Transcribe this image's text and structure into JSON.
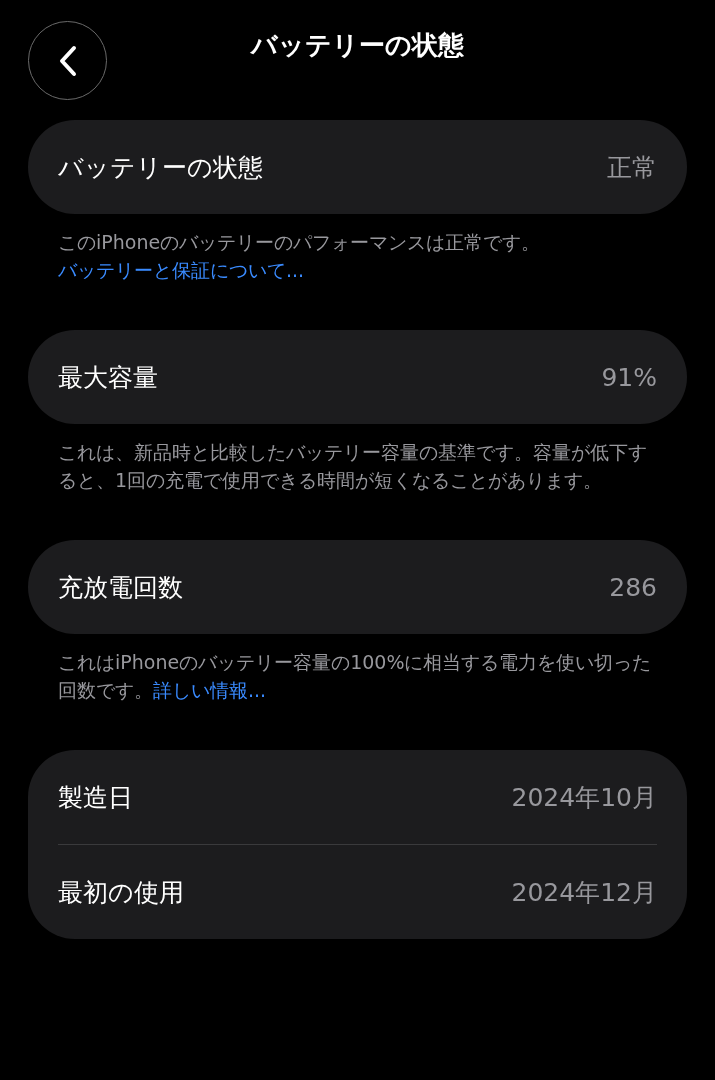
{
  "header": {
    "title": "バッテリーの状態"
  },
  "groups": [
    {
      "rows": [
        {
          "label": "バッテリーの状態",
          "value": "正常"
        }
      ],
      "footer": {
        "text": "このiPhoneのバッテリーのパフォーマンスは正常です。",
        "link": "バッテリーと保証について..."
      }
    },
    {
      "rows": [
        {
          "label": "最大容量",
          "value": "91%"
        }
      ],
      "footer": {
        "text": "これは、新品時と比較したバッテリー容量の基準です。容量が低下すると、1回の充電で使用できる時間が短くなることがあります。"
      }
    },
    {
      "rows": [
        {
          "label": "充放電回数",
          "value": "286"
        }
      ],
      "footer": {
        "text": "これはiPhoneのバッテリー容量の100%に相当する電力を使い切った回数です。",
        "link": "詳しい情報..."
      }
    },
    {
      "rows": [
        {
          "label": "製造日",
          "value": "2024年10月"
        },
        {
          "label": "最初の使用",
          "value": "2024年12月"
        }
      ]
    }
  ]
}
